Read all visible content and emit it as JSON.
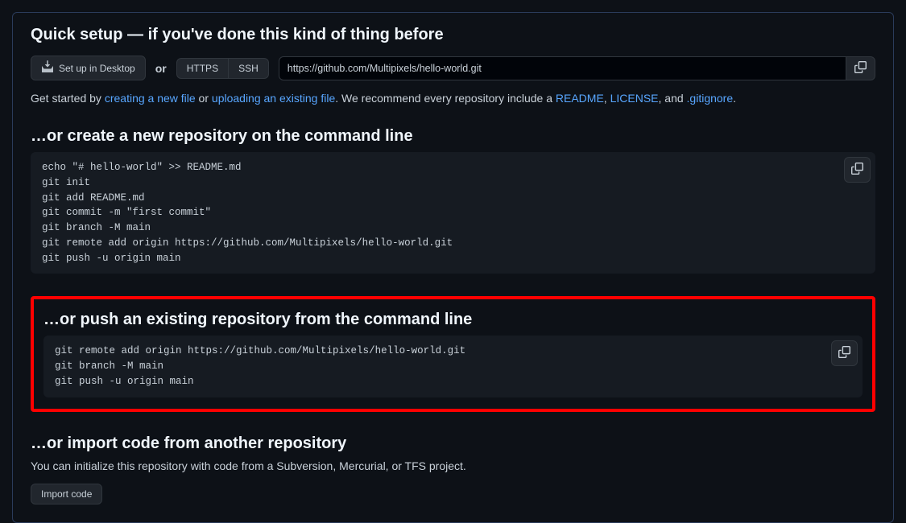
{
  "quickSetup": {
    "title": "Quick setup — if you've done this kind of thing before",
    "desktopBtn": "Set up in Desktop",
    "orText": "or",
    "httpsBtn": "HTTPS",
    "sshBtn": "SSH",
    "cloneUrl": "https://github.com/Multipixels/hello-world.git",
    "getStarted": {
      "prefix": "Get started by ",
      "link1": "creating a new file",
      "mid1": " or ",
      "link2": "uploading an existing file",
      "mid2": ". We recommend every repository include a ",
      "link3": "README",
      "sep1": ", ",
      "link4": "LICENSE",
      "sep2": ", and ",
      "link5": ".gitignore",
      "suffix": "."
    }
  },
  "createSection": {
    "title": "…or create a new repository on the command line",
    "code": "echo \"# hello-world\" >> README.md\ngit init\ngit add README.md\ngit commit -m \"first commit\"\ngit branch -M main\ngit remote add origin https://github.com/Multipixels/hello-world.git\ngit push -u origin main"
  },
  "pushSection": {
    "title": "…or push an existing repository from the command line",
    "code": "git remote add origin https://github.com/Multipixels/hello-world.git\ngit branch -M main\ngit push -u origin main"
  },
  "importSection": {
    "title": "…or import code from another repository",
    "desc": "You can initialize this repository with code from a Subversion, Mercurial, or TFS project.",
    "btn": "Import code"
  }
}
